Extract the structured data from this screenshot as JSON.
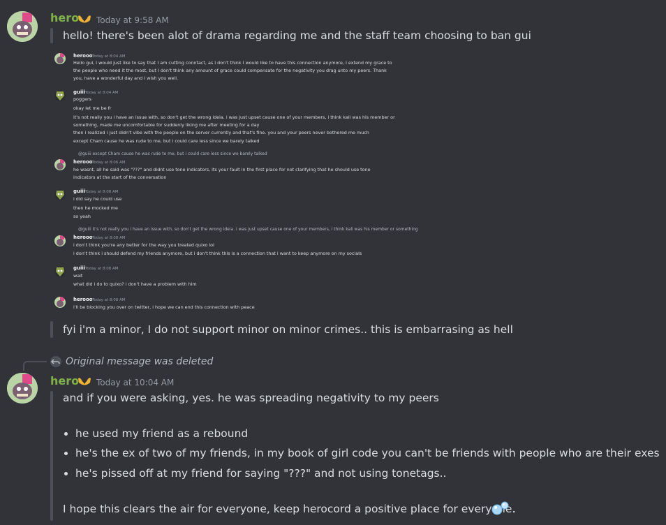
{
  "colors": {
    "background": "#313338",
    "username": "#7fb04a",
    "timestamp": "#949ba4",
    "text": "#dbdee1"
  },
  "message1": {
    "username": "hero",
    "timestamp": "Today at 9:58 AM",
    "line1": "hello! there's been alot of drama regarding me and the staff team choosing to ban gui",
    "line2": "fyi i'm a minor, I do not support minor on minor crimes.. this is embarrasing as hell"
  },
  "screenshot": {
    "m1": {
      "name": "herooo",
      "time": "Today at 8:04 AM",
      "lines": [
        "Hello gui, I would just like to say that I am cutting conntact, as I don't think I would like to have this connection anymore, I extend my grace to",
        "the people who need it the most, but I don't think any amount of grace could compensate for the negativity you drag unto my peers. Thank",
        "you, have a wonderful day and I wish you well."
      ]
    },
    "m2": {
      "name": "guiii",
      "time": "Today at 8:04 AM",
      "lines": [
        "poggers",
        "okay let me be fr",
        "it's not really you i have an issue with, so don't get the wrong ideia. i was just upset cause one of your members, i think kali was his member or",
        "something, made me uncomfortable for suddenly liking me after meeting for a day",
        "then i realized i just didn't vibe with the people on the server currently and that's fine. you and your peers never bothered me much",
        "except Cham cause he was rude to me, but i could care less since we barely talked"
      ]
    },
    "m3": {
      "reply": "@guiii except Cham cause he was rude to me, but i could care less since we barely talked",
      "name": "herooo",
      "time": "Today at 8:06 AM",
      "lines": [
        "he wasnt, all he said was \"???\" and didnt use tone indicators, its your fault in the first place for not clarifying that he should use tone",
        "indicators at the start of the conversation"
      ]
    },
    "m4": {
      "name": "guiii",
      "time": "Today at 8:08 AM",
      "lines": [
        "i did say he could use",
        "then he mocked me",
        "so yeah"
      ]
    },
    "m5": {
      "reply": "@guiii it's not really you i have an issue with, so don't get the wrong ideia. i was just upset cause one of your members, i think kali was his member or something",
      "name": "herooo",
      "time": "Today at 8:08 AM",
      "lines": [
        "i don't think you're any better for the way you treated quixo lol",
        "i don't think i should defend my friends anymore, but i don't think this is a connection that i want to keep anymore on my socials"
      ]
    },
    "m6": {
      "name": "guiii",
      "time": "Today at 8:08 AM",
      "lines": [
        "wait",
        "what did i do to quixo? i don't have a problem with him"
      ]
    },
    "m7": {
      "name": "herooo",
      "time": "Today at 8:08 AM",
      "lines": [
        "i'll be blocking you over on twitter, i hope we can end this connection with peace"
      ]
    }
  },
  "reply_preview": {
    "text": "Original message was deleted"
  },
  "message2": {
    "username": "hero",
    "timestamp": "Today at 10:04 AM",
    "intro": "and if you were asking, yes. he was spreading negativity to my peers",
    "bullets": [
      "he used my friend as a rebound",
      "he's the ex of two of my friends, in my book of girl code you can't be friends with people who are their exes",
      "he's pissed off at my friend for saying \"???\" and not using tonetags.."
    ],
    "closing": "I hope this clears the air for everyone, keep herocord a positive place for everyone.",
    "closing_end": "."
  }
}
